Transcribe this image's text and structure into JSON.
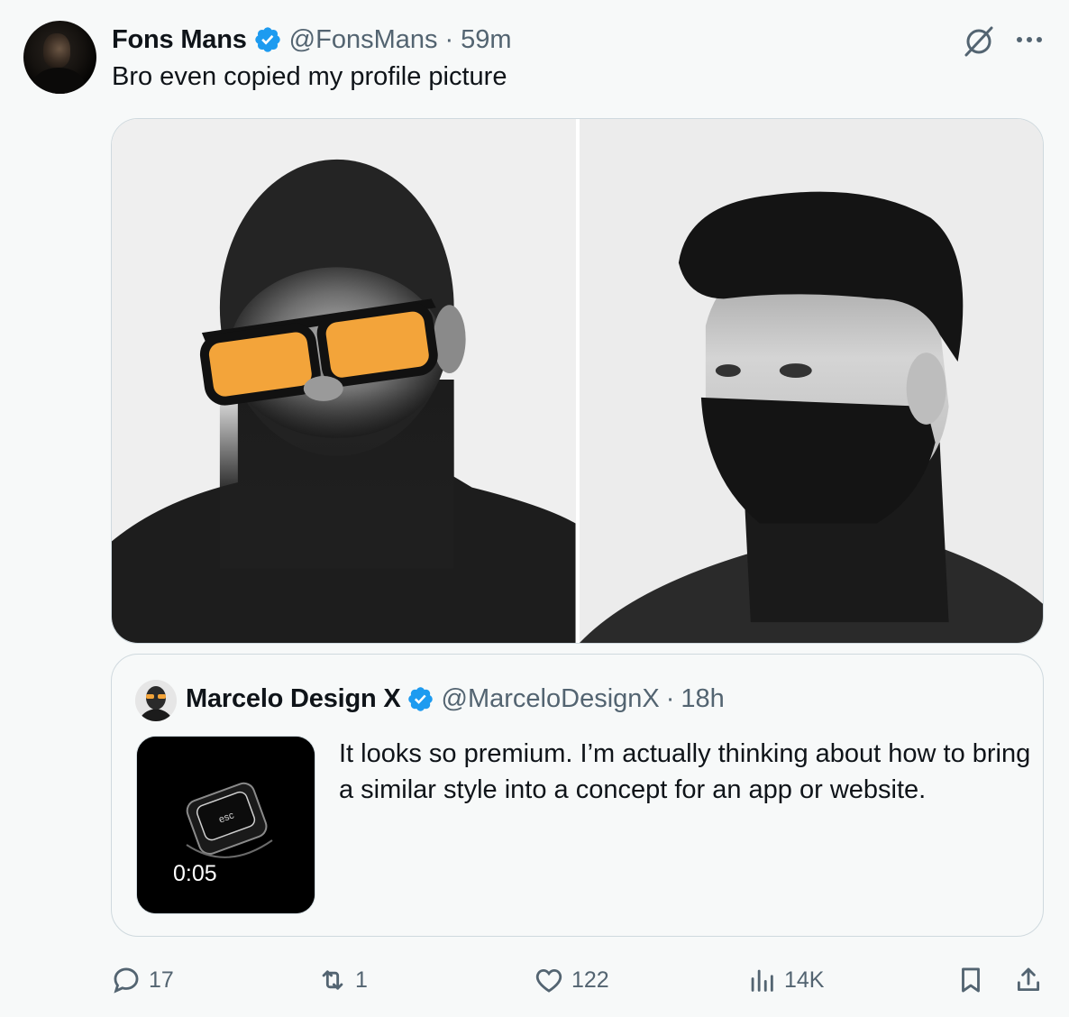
{
  "tweet": {
    "author_name": "Fons Mans",
    "handle": "@FonsMans",
    "separator": "·",
    "time": "59m",
    "text": "Bro even copied my profile picture",
    "verified": true
  },
  "icons": {
    "verified": "verified-badge-icon",
    "grok": "grok-icon",
    "more": "more-options-icon",
    "reply": "reply-icon",
    "retweet": "retweet-icon",
    "like": "heart-icon",
    "views": "views-chart-icon",
    "bookmark": "bookmark-icon",
    "share": "share-icon"
  },
  "colors": {
    "verified_blue": "#1d9bf0",
    "secondary_text": "#536471",
    "primary_text": "#0f1419",
    "border": "#cfd9de",
    "glasses_tint": "#f3a43a"
  },
  "media": {
    "images": [
      {
        "description_name": "portrait-bald-man-orange-glasses"
      },
      {
        "description_name": "portrait-man-side-profile"
      }
    ]
  },
  "quote": {
    "author_name": "Marcelo Design X",
    "handle": "@MarceloDesignX",
    "separator": "·",
    "time": "18h",
    "verified": true,
    "text": "It looks so premium. I’m actually thinking about how to bring a similar style into a concept for an app or website.",
    "video_duration": "0:05",
    "video_key_label": "esc"
  },
  "actions": {
    "replies": "17",
    "retweets": "1",
    "likes": "122",
    "views": "14K"
  }
}
